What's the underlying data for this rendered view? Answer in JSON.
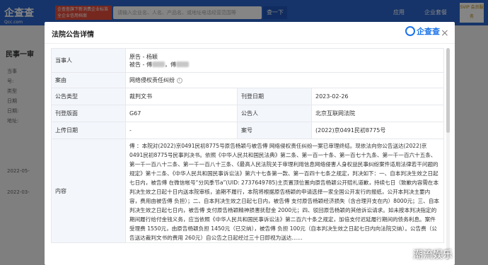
{
  "background": {
    "logo": "企查查",
    "logo_sub": "Qcc.com",
    "promo": "企查查旗下新消费企业标准全企业信用档案",
    "search_placeholder": "请输入企业名、人名、产品名、或地址电话经营范围等",
    "search_button": "查一下",
    "nav": [
      "应用",
      "企业套餐"
    ],
    "svip": "SVIP 会员服务",
    "section_title": "民事一审",
    "left_lines": [
      "当事",
      "号:",
      "类型",
      "日期",
      "日期:",
      "地址:"
    ],
    "left_dates": [
      "2022-05-",
      "2022-03-"
    ]
  },
  "modal": {
    "title": "法院公告详情",
    "brand": "企查查",
    "close": "×",
    "rows": {
      "party_label": "当事人",
      "party_plaintiff": "原告 - 杨颖",
      "party_defendant_prefix": "被告 - 傅",
      "party_defendant_mid": "，傅",
      "cause_label": "案由",
      "cause_value": "网络侵权责任纠纷",
      "type_label": "公告类型",
      "type_value": "裁判文书",
      "date_label": "刊登日期",
      "date_value": "2023-02-26",
      "page_label": "刊登版面",
      "page_value": "G67",
      "announcer_label": "公告人",
      "announcer_value": "北京互联网法院",
      "upload_label": "上传日期",
      "upload_value": "-",
      "case_label": "案号",
      "case_value": "(2022)京0491民初8775号",
      "content_label": "内容",
      "content_text": "傅 ：本院对(2022)京0491民初8775号原告杨颖与被告傅 网络侵权责任纠纷一案已审理终结。现依法向你公告送达(2022)京0491民初8775号民事判决书。依照《中华人民共和国民法典》第二条、第一百一十条、第一百七十九条、第一千一百六十五条、第一千一百八十二条、第一千一百八十三条、《最高人民法院关于审理利用信息网络侵害人身权益民事纠纷案件适用法律若干问题的规定》第十二条、《中华人民共和国民事诉讼法》第六十七条第一款、第一百四十七条之规定，判决如下：一、自本判决生效之日起七日内，被告傅 在微信帐号“分风季节a”(UID: 2737649785)主页置顶位置向原告杨颖公开赔礼道歉，持续七日（致歉内容需在本判决生效之日起十日内送本院审核，逾期不履行，本院将根据原告杨颖的申请选择一家全国公开发行的报纸，公开本判决主要内容，费用由被告傅 负担）；二、自本判决生效之日起七日内，被告傅 支付原告杨颖经济损失（含合理开支在内）8000元；三、自本判决生效之日起七日内，被告傅 支付原告杨颖精神损害抚慰金 2000元；四、驳回原告杨颖的其他诉讼请求。如未按本判决指定的期间履行给付金钱义务，应当依照《中华人民共和国民事诉讼法》第二百六十条之规定，加倍支付迟延履行期间的债务利息。案件受理费 1550元，由原告杨颖负担 1450元（已交纳），被告傅 负担 100元（自本判决生效之日起七日内向法院交纳）。公告费（公告送达裁判文书的费用 260元）自公告之日起经过三十日即视为送达……"
    }
  },
  "watermark": "潮流娱乐"
}
